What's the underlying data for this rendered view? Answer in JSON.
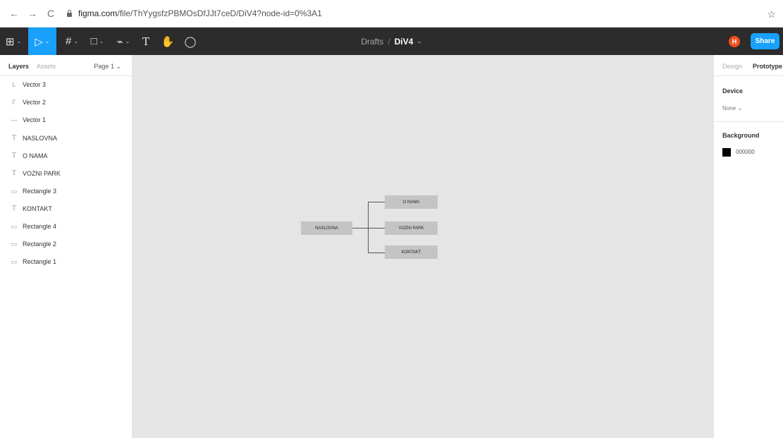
{
  "browser": {
    "back": "←",
    "forward": "→",
    "reload": "C",
    "url_host": "figma.com",
    "url_path": "/file/ThYygsfzPBMOsDfJJt7ceD/DiV4?node-id=0%3A1",
    "star": "☆"
  },
  "toolbar": {
    "main_menu": "⊞",
    "move_tool": "▷",
    "frame_tool": "#",
    "shape_tool": "□",
    "pen_tool": "⌁",
    "text_tool": "T",
    "hand_tool": "✋",
    "comment_tool": "◯",
    "chevron": "⌄",
    "breadcrumb_drafts": "Drafts",
    "breadcrumb_sep": "/",
    "file_name": "DiV4",
    "user_initial": "H",
    "share_label": "Share"
  },
  "left_panel": {
    "tabs": [
      "Layers",
      "Assets"
    ],
    "page": "Page 1 ⌄",
    "layers": [
      {
        "icon": "L",
        "name": "Vector 3"
      },
      {
        "icon": "Γ",
        "name": "Vector 2"
      },
      {
        "icon": "—",
        "name": "Vector 1"
      },
      {
        "icon": "T",
        "name": "NASLOVNA"
      },
      {
        "icon": "T",
        "name": "O NAMA"
      },
      {
        "icon": "T",
        "name": "VOZNI PARK"
      },
      {
        "icon": "▭",
        "name": "Rectangle 3"
      },
      {
        "icon": "T",
        "name": "KONTAKT"
      },
      {
        "icon": "▭",
        "name": "Rectangle 4"
      },
      {
        "icon": "▭",
        "name": "Rectangle 2"
      },
      {
        "icon": "▭",
        "name": "Rectangle 1"
      }
    ]
  },
  "canvas": {
    "nodes": {
      "root": "NASLOVNA",
      "child1": "O NAMA",
      "child2": "VOZNI PARK",
      "child3": "KONTAKT"
    },
    "background_color": "#e5e5e5",
    "node_color": "#c4c4c4"
  },
  "right_panel": {
    "tabs": [
      "Design",
      "Prototype"
    ],
    "device_title": "Device",
    "device_value": "None ⌄",
    "background_title": "Background",
    "background_value": "000000",
    "background_color": "#000000"
  },
  "colors": {
    "accent": "#18a0fb",
    "toolbar_bg": "#2c2c2c",
    "avatar": "#f24e1e"
  }
}
